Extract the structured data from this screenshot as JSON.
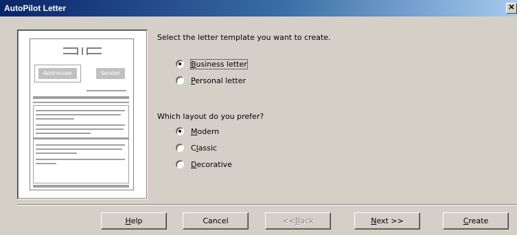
{
  "window": {
    "title": "AutoPilot Letter",
    "close_glyph": "✕"
  },
  "preview": {
    "addressee": "Addressee",
    "sender": "Sender"
  },
  "template_prompt": "Select the letter template you want to create.",
  "template_options": [
    {
      "pre": "",
      "accel": "B",
      "post": "usiness letter",
      "checked": true
    },
    {
      "pre": "",
      "accel": "P",
      "post": "ersonal letter",
      "checked": false
    }
  ],
  "layout_prompt": "Which layout do you prefer?",
  "layout_options": [
    {
      "pre": "",
      "accel": "M",
      "post": "odern",
      "checked": true
    },
    {
      "pre": "C",
      "accel": "l",
      "post": "assic",
      "checked": false
    },
    {
      "pre": "",
      "accel": "D",
      "post": "ecorative",
      "checked": false
    }
  ],
  "buttons": {
    "help": {
      "pre": "",
      "accel": "H",
      "post": "elp"
    },
    "cancel": {
      "label": "Cancel"
    },
    "back": {
      "pre": "<< ",
      "accel": "B",
      "post": "ack"
    },
    "next": {
      "pre": "",
      "accel": "N",
      "post": "ext >>"
    },
    "create": {
      "pre": "",
      "accel": "C",
      "post": "reate"
    }
  }
}
